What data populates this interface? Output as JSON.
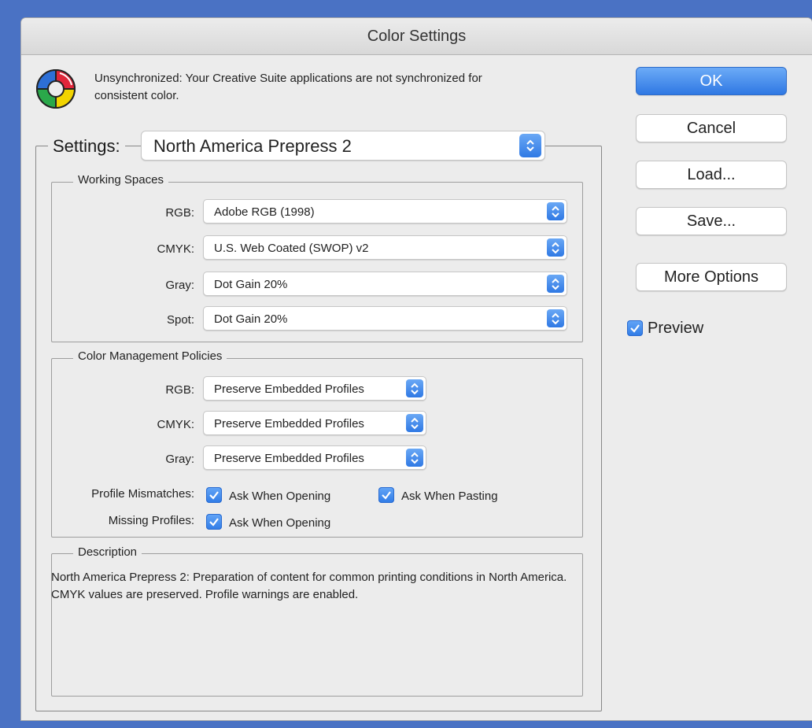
{
  "window": {
    "title": "Color Settings"
  },
  "sync_message": "Unsynchronized: Your Creative Suite applications are not synchronized for consistent color.",
  "settings": {
    "label": "Settings:",
    "value": "North America Prepress 2"
  },
  "working_spaces": {
    "legend": "Working Spaces",
    "rows": [
      {
        "label": "RGB:",
        "value": "Adobe RGB (1998)"
      },
      {
        "label": "CMYK:",
        "value": "U.S. Web Coated (SWOP) v2"
      },
      {
        "label": "Gray:",
        "value": "Dot Gain 20%"
      },
      {
        "label": "Spot:",
        "value": "Dot Gain 20%"
      }
    ]
  },
  "policies": {
    "legend": "Color Management Policies",
    "rows": [
      {
        "label": "RGB:",
        "value": "Preserve Embedded Profiles"
      },
      {
        "label": "CMYK:",
        "value": "Preserve Embedded Profiles"
      },
      {
        "label": "Gray:",
        "value": "Preserve Embedded Profiles"
      }
    ],
    "profile_mismatches": {
      "label": "Profile Mismatches:",
      "ask_opening": {
        "label": "Ask When Opening",
        "checked": true
      },
      "ask_pasting": {
        "label": "Ask When Pasting",
        "checked": true
      }
    },
    "missing_profiles": {
      "label": "Missing Profiles:",
      "ask_opening": {
        "label": "Ask When Opening",
        "checked": true
      }
    }
  },
  "description": {
    "legend": "Description",
    "text": "North America Prepress 2:  Preparation of content for common printing conditions in North America. CMYK values are preserved. Profile warnings are enabled."
  },
  "buttons": {
    "ok": "OK",
    "cancel": "Cancel",
    "load": "Load...",
    "save": "Save...",
    "more_options": "More Options"
  },
  "preview": {
    "label": "Preview",
    "checked": true
  },
  "colors": {
    "accent": "#2f78e3",
    "desktop": "#4a72c4",
    "window_bg": "#ececec"
  }
}
